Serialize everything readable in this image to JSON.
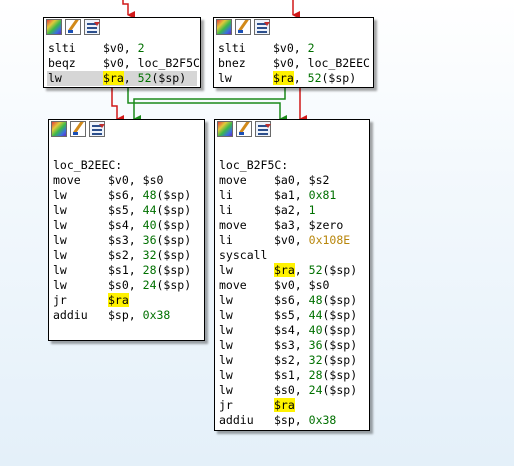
{
  "colors": {
    "edge_true": "#1a8a1a",
    "edge_false": "#d01818",
    "edge_plain": "#333333",
    "highlight": "#fff200",
    "immediate": "#007000",
    "hex_immediate": "#b8860b"
  },
  "node_toolbar_icons": [
    "color-palette-icon",
    "edit-node-icon",
    "node-list-icon"
  ],
  "nodes": {
    "n1": {
      "lines": [
        {
          "mn": "slti",
          "op": [
            {
              "t": "$v0"
            },
            {
              "t": ", "
            },
            {
              "t": "2",
              "c": "num"
            }
          ]
        },
        {
          "mn": "beqz",
          "op": [
            {
              "t": "$v0"
            },
            {
              "t": ", "
            },
            {
              "t": "loc_B2F5C"
            }
          ]
        },
        {
          "mn": "lw",
          "sel": true,
          "op": [
            {
              "t": "$ra",
              "c": "hl"
            },
            {
              "t": ", "
            },
            {
              "t": "52",
              "c": "num"
            },
            {
              "t": "($sp)"
            }
          ]
        }
      ]
    },
    "n2": {
      "lines": [
        {
          "mn": "slti",
          "op": [
            {
              "t": "$v0"
            },
            {
              "t": ", "
            },
            {
              "t": "2",
              "c": "num"
            }
          ]
        },
        {
          "mn": "bnez",
          "op": [
            {
              "t": "$v0"
            },
            {
              "t": ", "
            },
            {
              "t": "loc_B2EEC"
            }
          ]
        },
        {
          "mn": "lw",
          "op": [
            {
              "t": "$ra",
              "c": "hl"
            },
            {
              "t": ", "
            },
            {
              "t": "52",
              "c": "num"
            },
            {
              "t": "($sp)"
            }
          ]
        }
      ]
    },
    "n3": {
      "lines": [
        {
          "label": ""
        },
        {
          "label": "loc_B2EEC:"
        },
        {
          "mn": "move",
          "op": [
            {
              "t": "$v0"
            },
            {
              "t": ", "
            },
            {
              "t": "$s0"
            }
          ]
        },
        {
          "mn": "lw",
          "op": [
            {
              "t": "$s6"
            },
            {
              "t": ", "
            },
            {
              "t": "48",
              "c": "num"
            },
            {
              "t": "($sp)"
            }
          ]
        },
        {
          "mn": "lw",
          "op": [
            {
              "t": "$s5"
            },
            {
              "t": ", "
            },
            {
              "t": "44",
              "c": "num"
            },
            {
              "t": "($sp)"
            }
          ]
        },
        {
          "mn": "lw",
          "op": [
            {
              "t": "$s4"
            },
            {
              "t": ", "
            },
            {
              "t": "40",
              "c": "num"
            },
            {
              "t": "($sp)"
            }
          ]
        },
        {
          "mn": "lw",
          "op": [
            {
              "t": "$s3"
            },
            {
              "t": ", "
            },
            {
              "t": "36",
              "c": "num"
            },
            {
              "t": "($sp)"
            }
          ]
        },
        {
          "mn": "lw",
          "op": [
            {
              "t": "$s2"
            },
            {
              "t": ", "
            },
            {
              "t": "32",
              "c": "num"
            },
            {
              "t": "($sp)"
            }
          ]
        },
        {
          "mn": "lw",
          "op": [
            {
              "t": "$s1"
            },
            {
              "t": ", "
            },
            {
              "t": "28",
              "c": "num"
            },
            {
              "t": "($sp)"
            }
          ]
        },
        {
          "mn": "lw",
          "op": [
            {
              "t": "$s0"
            },
            {
              "t": ", "
            },
            {
              "t": "24",
              "c": "num"
            },
            {
              "t": "($sp)"
            }
          ]
        },
        {
          "mn": "jr",
          "op": [
            {
              "t": "$ra",
              "c": "hl"
            }
          ]
        },
        {
          "mn": "addiu",
          "op": [
            {
              "t": "$sp"
            },
            {
              "t": ", "
            },
            {
              "t": "0x38",
              "c": "num"
            }
          ]
        }
      ]
    },
    "n4": {
      "lines": [
        {
          "label": ""
        },
        {
          "label": "loc_B2F5C:"
        },
        {
          "mn": "move",
          "op": [
            {
              "t": "$a0"
            },
            {
              "t": ", "
            },
            {
              "t": "$s2"
            }
          ]
        },
        {
          "mn": "li",
          "op": [
            {
              "t": "$a1"
            },
            {
              "t": ", "
            },
            {
              "t": "0x81",
              "c": "num"
            }
          ]
        },
        {
          "mn": "li",
          "op": [
            {
              "t": "$a2"
            },
            {
              "t": ", "
            },
            {
              "t": "1",
              "c": "num"
            }
          ]
        },
        {
          "mn": "move",
          "op": [
            {
              "t": "$a3"
            },
            {
              "t": ", "
            },
            {
              "t": "$zero"
            }
          ]
        },
        {
          "mn": "li",
          "op": [
            {
              "t": "$v0"
            },
            {
              "t": ", "
            },
            {
              "t": "0x108E",
              "c": "hex"
            }
          ]
        },
        {
          "mn": "syscall",
          "op": []
        },
        {
          "mn": "lw",
          "op": [
            {
              "t": "$ra",
              "c": "hl"
            },
            {
              "t": ", "
            },
            {
              "t": "52",
              "c": "num"
            },
            {
              "t": "($sp)"
            }
          ]
        },
        {
          "mn": "move",
          "op": [
            {
              "t": "$v0"
            },
            {
              "t": ", "
            },
            {
              "t": "$s0"
            }
          ]
        },
        {
          "mn": "lw",
          "op": [
            {
              "t": "$s6"
            },
            {
              "t": ", "
            },
            {
              "t": "48",
              "c": "num"
            },
            {
              "t": "($sp)"
            }
          ]
        },
        {
          "mn": "lw",
          "op": [
            {
              "t": "$s5"
            },
            {
              "t": ", "
            },
            {
              "t": "44",
              "c": "num"
            },
            {
              "t": "($sp)"
            }
          ]
        },
        {
          "mn": "lw",
          "op": [
            {
              "t": "$s4"
            },
            {
              "t": ", "
            },
            {
              "t": "40",
              "c": "num"
            },
            {
              "t": "($sp)"
            }
          ]
        },
        {
          "mn": "lw",
          "op": [
            {
              "t": "$s3"
            },
            {
              "t": ", "
            },
            {
              "t": "36",
              "c": "num"
            },
            {
              "t": "($sp)"
            }
          ]
        },
        {
          "mn": "lw",
          "op": [
            {
              "t": "$s2"
            },
            {
              "t": ", "
            },
            {
              "t": "32",
              "c": "num"
            },
            {
              "t": "($sp)"
            }
          ]
        },
        {
          "mn": "lw",
          "op": [
            {
              "t": "$s1"
            },
            {
              "t": ", "
            },
            {
              "t": "28",
              "c": "num"
            },
            {
              "t": "($sp)"
            }
          ]
        },
        {
          "mn": "lw",
          "op": [
            {
              "t": "$s0"
            },
            {
              "t": ", "
            },
            {
              "t": "24",
              "c": "num"
            },
            {
              "t": "($sp)"
            }
          ]
        },
        {
          "mn": "jr",
          "op": [
            {
              "t": "$ra",
              "c": "hl"
            }
          ]
        },
        {
          "mn": "addiu",
          "op": [
            {
              "t": "$sp"
            },
            {
              "t": ", "
            },
            {
              "t": "0x38",
              "c": "num"
            }
          ]
        }
      ]
    }
  }
}
